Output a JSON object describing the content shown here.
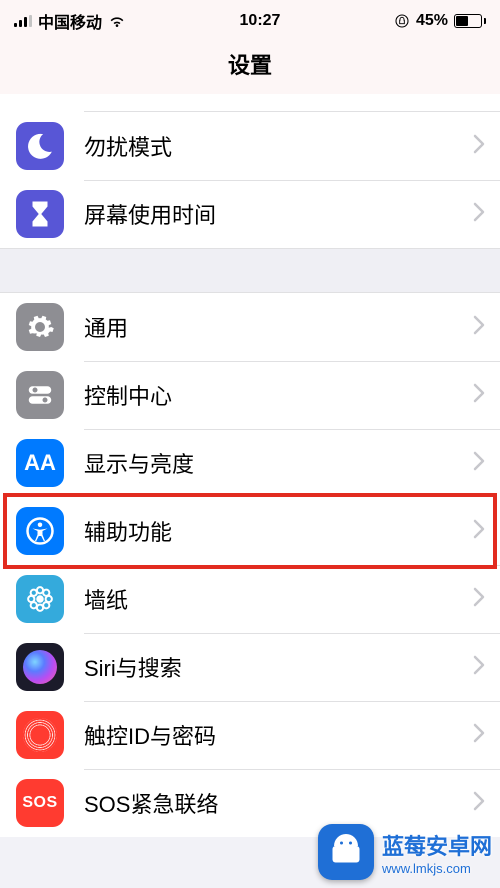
{
  "status": {
    "carrier": "中国移动",
    "time": "10:27",
    "battery_pct": "45%"
  },
  "header": {
    "title": "设置"
  },
  "groupA": {
    "dnd": {
      "label": "勿扰模式"
    },
    "screentime": {
      "label": "屏幕使用时间"
    }
  },
  "groupB": {
    "general": {
      "label": "通用"
    },
    "control": {
      "label": "控制中心"
    },
    "display": {
      "label": "显示与亮度"
    },
    "accessibility": {
      "label": "辅助功能",
      "highlighted": true
    },
    "wallpaper": {
      "label": "墙纸"
    },
    "siri": {
      "label": "Siri与搜索"
    },
    "touchid": {
      "label": "触控ID与密码"
    },
    "sos": {
      "label": "SOS紧急联络"
    }
  },
  "watermark": {
    "text": "蓝莓安卓网",
    "sub": "www.lmkjs.com"
  },
  "icons": {
    "display_text": "AA",
    "sos_text": "SOS"
  }
}
